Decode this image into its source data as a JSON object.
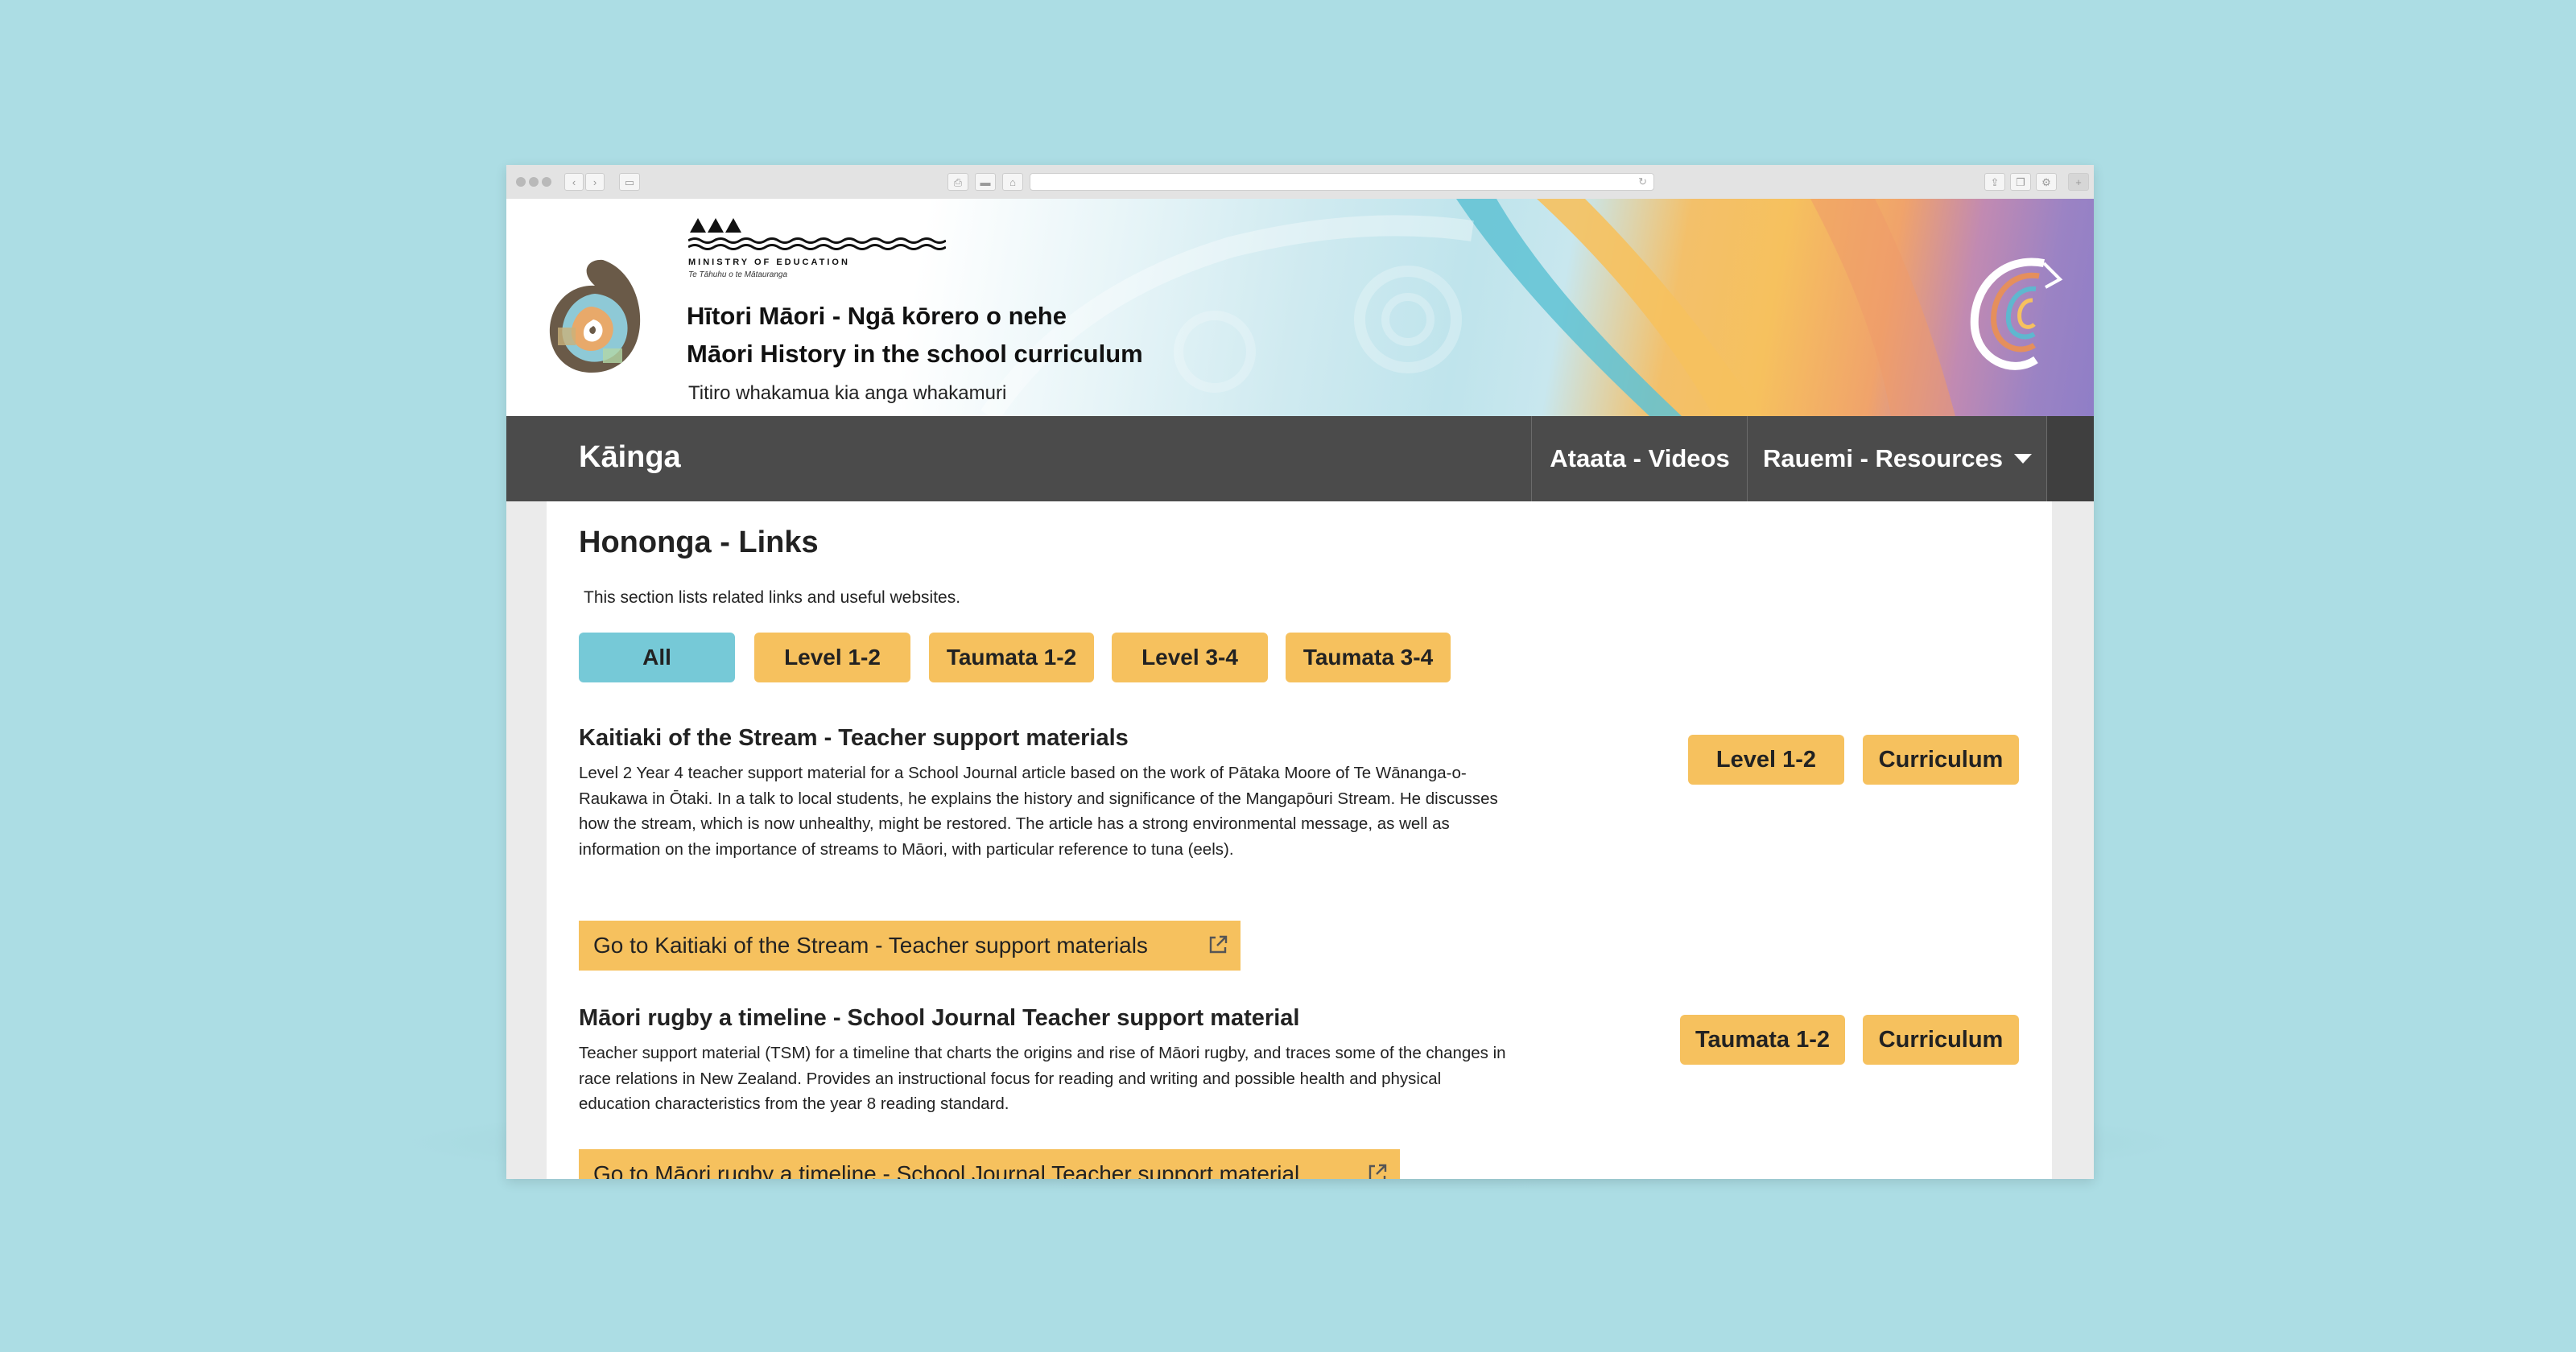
{
  "header": {
    "ministry_name": "MINISTRY OF EDUCATION",
    "ministry_maori": "Te Tāhuhu o te Mātauranga",
    "title_maori": "Hītori Māori - Ngā kōrero o nehe",
    "title_english": "Māori History in the school curriculum",
    "tagline": "Titiro whakamua kia anga whakamuri"
  },
  "nav": {
    "home": "Kāinga",
    "videos": "Ataata - Videos",
    "resources": "Rauemi - Resources"
  },
  "page": {
    "title": "Hononga - Links",
    "intro": "This section lists related links and useful websites."
  },
  "filters": [
    "All",
    "Level 1-2",
    "Taumata 1-2",
    "Level 3-4",
    "Taumata 3-4"
  ],
  "items": [
    {
      "title": "Kaitiaki of the Stream - Teacher support materials",
      "description": "Level 2 Year 4 teacher support material for a School Journal article based on the work of Pātaka Moore of Te Wānanga-o-Raukawa in Ōtaki. In a talk to local students, he explains the history and significance of the Mangapōuri Stream. He discusses how the stream, which is now unhealthy, might be restored. The article has a strong environmental message, as well as information on the importance of streams to Māori, with particular reference to tuna (eels).",
      "link": "Go to Kaitiaki of the Stream - Teacher support materials",
      "tags": [
        "Level 1-2",
        "Curriculum"
      ]
    },
    {
      "title": "Māori rugby a timeline - School Journal Teacher support material",
      "description": "Teacher support material (TSM) for a timeline that charts the origins and rise of Māori rugby, and traces some of the changes in race relations in New Zealand. Provides an instructional focus for reading and writing and possible health and physical education characteristics from the year 8 reading standard.",
      "link": "Go to Māori rugby a timeline - School Journal Teacher support material",
      "tags": [
        "Taumata 1-2",
        "Curriculum"
      ]
    }
  ],
  "colors": {
    "background": "#acdde4",
    "nav": "#4b4b4b",
    "accent_yellow": "#f6c15e",
    "accent_teal": "#76c9d7"
  }
}
